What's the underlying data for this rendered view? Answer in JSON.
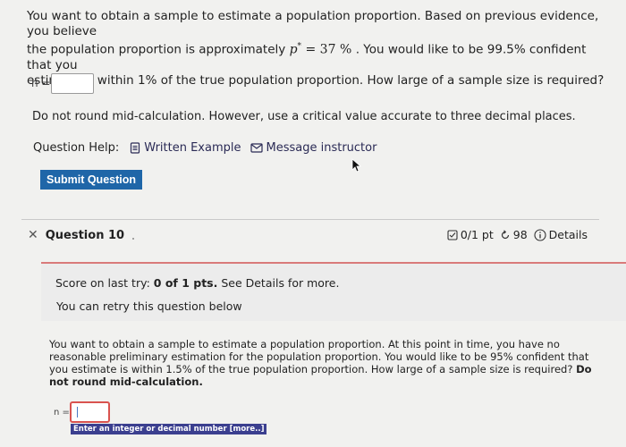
{
  "question9": {
    "line1": "You want to obtain a sample to estimate a population proportion. Based on previous evidence, you believe",
    "line2_before": "the population proportion is approximately ",
    "p_symbol": "p",
    "p_star": "*",
    "equals": " = 37 % ",
    "line2_after": ". You would like to be 99.5% confident that you",
    "line3": "estimate is within 1% of the true population proportion. How large of a sample size is required?",
    "n_label": "n =",
    "answer_value": "",
    "instruction": "Do not round mid-calculation. However, use a critical value accurate to three decimal places.",
    "help_label": "Question Help:",
    "written_example": "Written Example",
    "message_instructor": "Message instructor",
    "submit_label": "Submit Question"
  },
  "question10": {
    "title": "Question 10",
    "score_meta": "0/1 pt",
    "retries": "98",
    "details": "Details",
    "score_prefix": "Score on last try: ",
    "score_value": "0 of 1 pts.",
    "score_suffix": " See Details for more.",
    "retry_text": "You can retry this question below",
    "text": "You want to obtain a sample to estimate a population proportion. At this point in time, you have no reasonable preliminary estimation for the population proportion. You would like to be 95% confident that you estimate is within 1.5% of the true population proportion. How large of a sample size is required?",
    "text_bold": "Do not round mid-calculation.",
    "n_label": "n =",
    "hint": "Enter an integer or decimal number [more..]"
  }
}
